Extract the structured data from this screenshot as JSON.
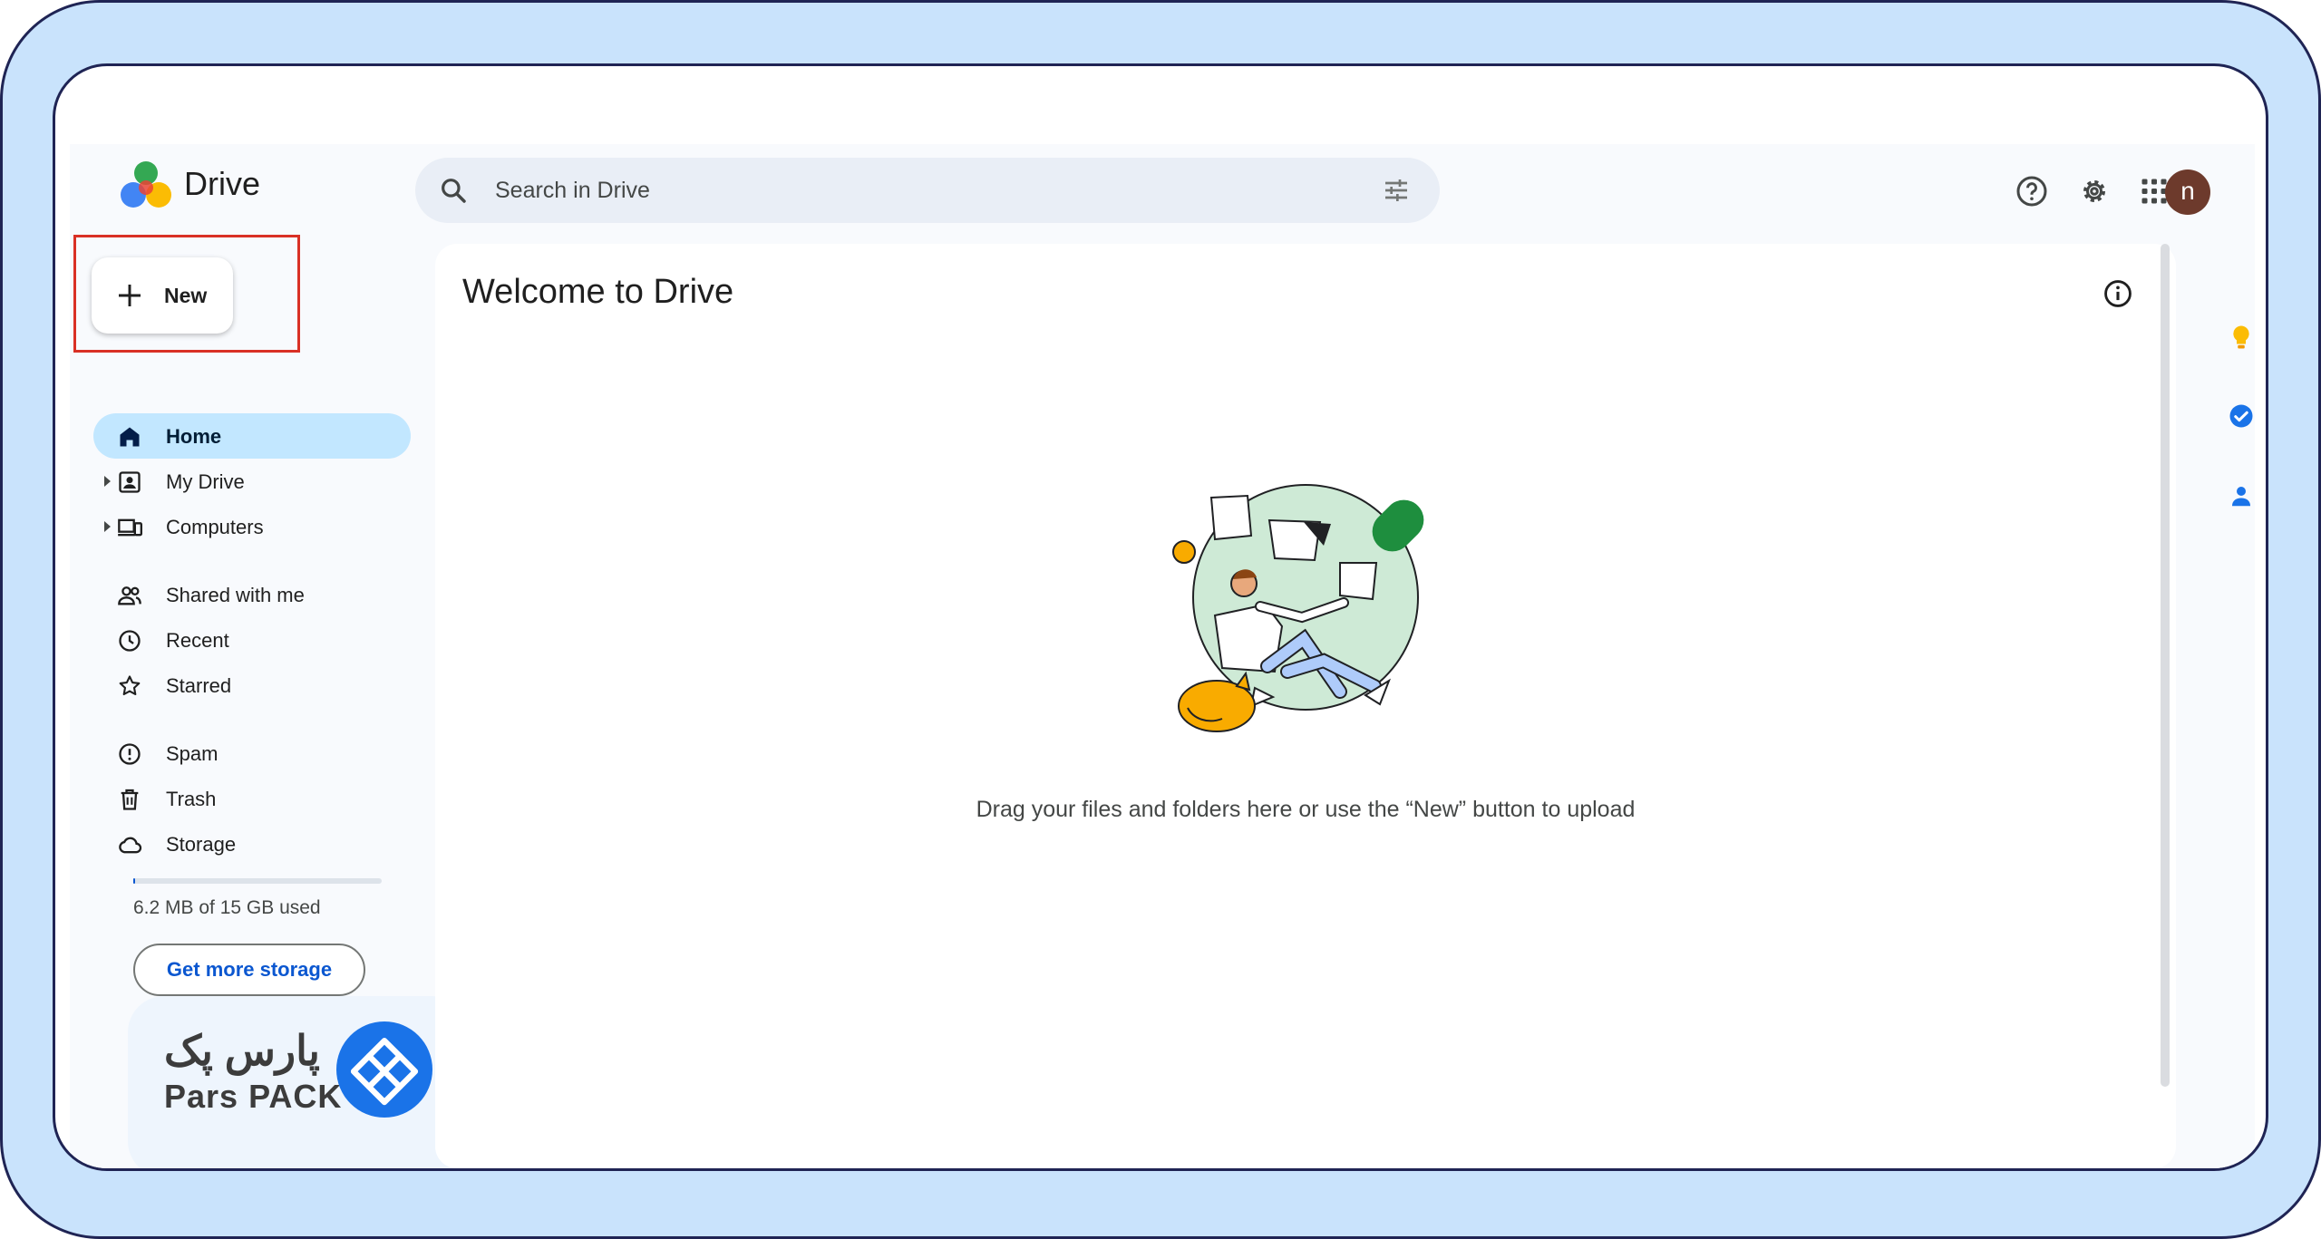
{
  "app": {
    "name": "Drive"
  },
  "search": {
    "placeholder": "Search in Drive"
  },
  "header": {
    "avatar_letter": "n"
  },
  "new_button": {
    "label": "New"
  },
  "sidebar": {
    "items": [
      {
        "label": "Home",
        "icon": "home-icon",
        "active": true
      },
      {
        "label": "My Drive",
        "icon": "my-drive-icon"
      },
      {
        "label": "Computers",
        "icon": "computers-icon"
      },
      {
        "label": "Shared with me",
        "icon": "shared-with-me-icon"
      },
      {
        "label": "Recent",
        "icon": "clock-icon"
      },
      {
        "label": "Starred",
        "icon": "star-icon"
      },
      {
        "label": "Spam",
        "icon": "spam-icon"
      },
      {
        "label": "Trash",
        "icon": "trash-icon"
      },
      {
        "label": "Storage",
        "icon": "cloud-icon"
      }
    ],
    "storage": {
      "used_text": "6.2 MB of 15 GB used",
      "used_fraction": 0.0004,
      "button_label": "Get more storage"
    }
  },
  "main": {
    "title": "Welcome to Drive",
    "empty_message": "Drag your files and folders here or use the “New” button to upload"
  },
  "watermark": {
    "persian": "پارس پک",
    "english": "Pars PACK"
  },
  "colors": {
    "accent": "#0b57d0",
    "active_nav": "#c2e7ff",
    "frame_border": "#1f2454",
    "frame_bg": "#c9e3fc",
    "highlight": "#d93025"
  }
}
